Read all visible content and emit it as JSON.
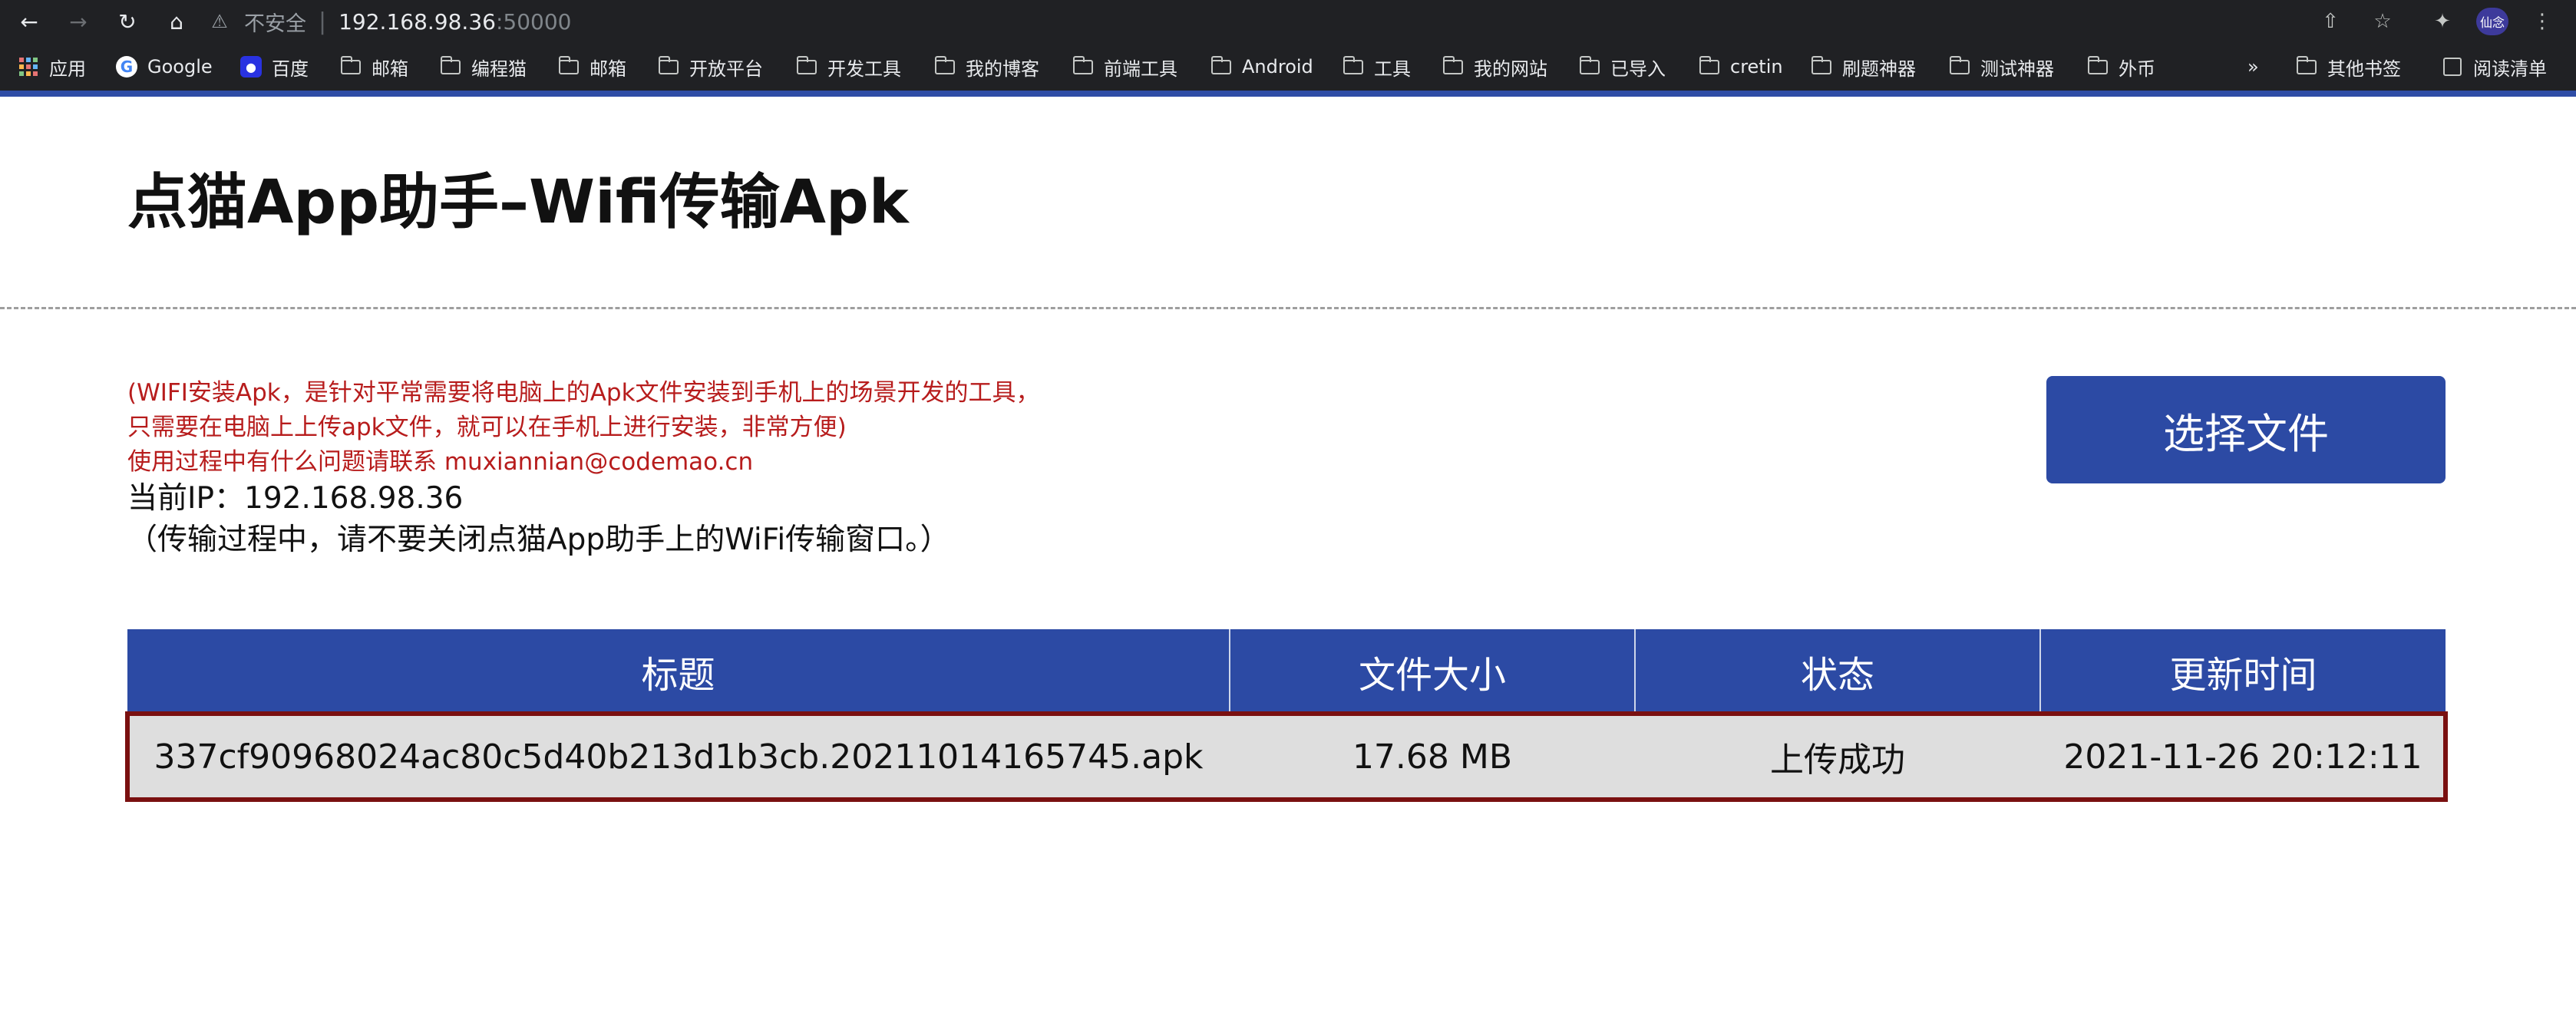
{
  "browser": {
    "not_secure": "不安全",
    "url_host": "192.168.98.36",
    "url_port": ":50000",
    "profile": "仙念"
  },
  "bookmarks": {
    "items": [
      "应用",
      "Google",
      "百度",
      "邮箱",
      "编程猫",
      "邮箱",
      "开放平台",
      "开发工具",
      "我的博客",
      "前端工具",
      "Android",
      "工具",
      "我的网站",
      "已导入",
      "cretin",
      "刷题神器",
      "测试神器",
      "外币"
    ],
    "overflow": "»",
    "other": "其他书签",
    "reading_list": "阅读清单"
  },
  "page": {
    "title": "点猫App助手–Wifi传输Apk",
    "notice": [
      "(WIFI安装Apk，是针对平常需要将电脑上的Apk文件安装到手机上的场景开发的工具，",
      "只需要在电脑上上传apk文件，就可以在手机上进行安装，非常方便)",
      "使用过程中有什么问题请联系 muxiannian@codemao.cn"
    ],
    "ip_line": "当前IP：192.168.98.36",
    "hint": "（传输过程中，请不要关闭点猫App助手上的WiFi传输窗口。）",
    "choose_button": "选择文件"
  },
  "table": {
    "headers": [
      "标题",
      "文件大小",
      "状态",
      "更新时间"
    ],
    "rows": [
      [
        "337cf90968024ac80c5d40b213d1b3cb.20211014165745.apk",
        "17.68 MB",
        "上传成功",
        "2021-11-26 20:12:11"
      ]
    ]
  },
  "colors": {
    "accent": "#2c4aa4",
    "notice_text": "#b71c1c",
    "selected_row_border": "#7a1010",
    "row_bg": "#dedede"
  }
}
